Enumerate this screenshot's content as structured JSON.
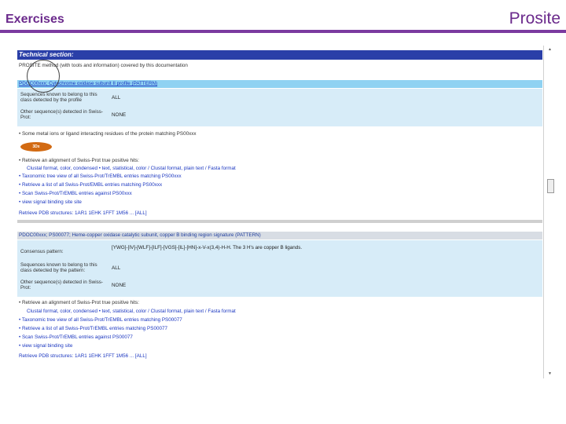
{
  "slide": {
    "title": "Exercises",
    "brand": "Prosite"
  },
  "tech_section": {
    "header": "Technical section:",
    "method_line": "PROSITE method (with tools and information) covered by this documentation"
  },
  "entry1": {
    "bar": "PDOC00xxx; Cytochrome oxidase subunit II profile (PATTERN)",
    "rows": [
      {
        "label": "Sequences known to belong to this class detected by the profile",
        "value": "ALL"
      },
      {
        "label": "Other sequence(s) detected in Swiss-Prot:",
        "value": "NONE"
      }
    ],
    "binding_note": "• Some metal ions or ligand interacting residues of the protein matching PS00xxx",
    "logo": "3Dx",
    "bullets": [
      "• Retrieve an alignment of Swiss-Prot true positive hits:",
      "Clustal format, color, condensed • text, statistical, color / Clustal format, plain text / Fasta format",
      "• Taxonomic tree view of all Swiss-Prot/TrEMBL entries matching PS00xxx",
      "• Retrieve a list of all Swiss-Prot/EMBL entries matching PS00xxx",
      "• Scan Swiss-Prot/TrEMBL entries against PS00xxx",
      "• view signal binding site site",
      "Retrieve PDB structures: 1AR1 1EHK 1FFT 1M56 ... [ALL]"
    ]
  },
  "entry2": {
    "bar": "PDOC00xxx; PS00077; Heme-copper oxidase catalytic subunit, copper B binding region signature (PATTERN)",
    "rows": [
      {
        "label": "Consensus pattern:",
        "value": "[YWG]-[IV]-[WLF]-[ILF]-[VGS]-[IL]-[HN]-x-V-x(3,4)-H-H. The 3 H's are copper B ligands."
      },
      {
        "label": "Sequences known to belong to this class detected by the pattern:",
        "value": "ALL"
      },
      {
        "label": "Other sequence(s) detected in Swiss-Prot:",
        "value": "NONE"
      }
    ],
    "bullets": [
      "• Retrieve an alignment of Swiss-Prot true positive hits:",
      "Clustal format, color, condensed • text, statistical, color / Clustal format, plain text / Fasta format",
      "• Taxonomic tree view of all Swiss-Prot/TrEMBL entries matching PS00077",
      "• Retrieve a list of all Swiss-Prot/TrEMBL entries matching PS00077",
      "• Scan Swiss-Prot/TrEMBL entries against PS00077",
      "• view signal binding site",
      "Retrieve PDB structures: 1AR1 1EHK 1FFT 1M56 ... [ALL]"
    ]
  },
  "scrollbar": {
    "up": "▲",
    "down": "▼"
  }
}
